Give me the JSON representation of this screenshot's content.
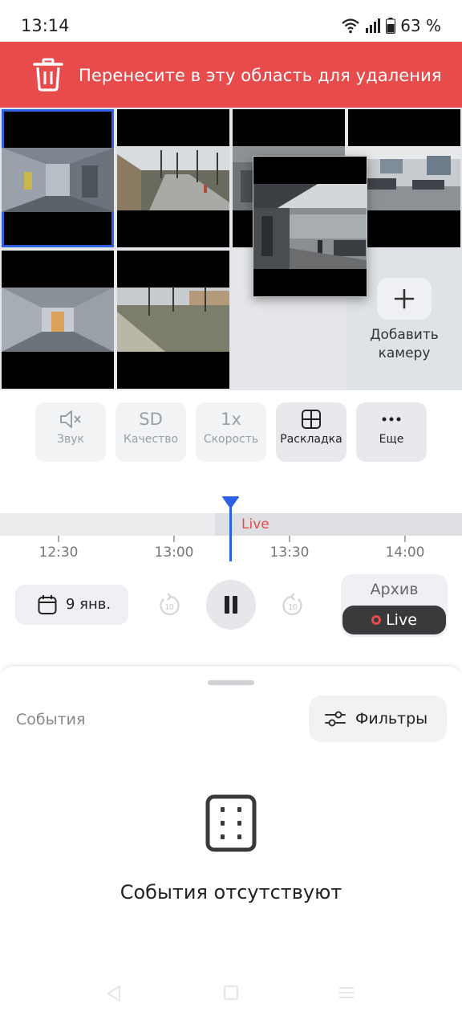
{
  "status_bar": {
    "time": "13:14",
    "battery_text": "63 %"
  },
  "delete_banner": {
    "text": "Перенесите в эту область для удаления",
    "color": "#e84b4b"
  },
  "grid": {
    "add_camera_label_line1": "Добавить",
    "add_camera_label_line2": "камеру"
  },
  "controls": [
    {
      "icon": "mute-icon",
      "label": "Звук"
    },
    {
      "icon_text": "SD",
      "label": "Качество"
    },
    {
      "icon_text": "1x",
      "label": "Скорость"
    },
    {
      "icon": "layout-grid-icon",
      "label": "Раскладка"
    },
    {
      "icon": "more-dots-icon",
      "label": "Еще"
    }
  ],
  "timeline": {
    "live_label": "Live",
    "ticks": [
      "12:30",
      "13:00",
      "13:30",
      "14:00"
    ]
  },
  "playback": {
    "date": "9 янв.",
    "seek_back": "10",
    "seek_forward": "10",
    "mode_archive": "Архив",
    "mode_live": "Live"
  },
  "events": {
    "title": "События",
    "filters_label": "Фильтры",
    "empty_text": "События отсутствуют"
  },
  "colors": {
    "accent": "#2a62e3",
    "danger": "#e84b4b"
  }
}
